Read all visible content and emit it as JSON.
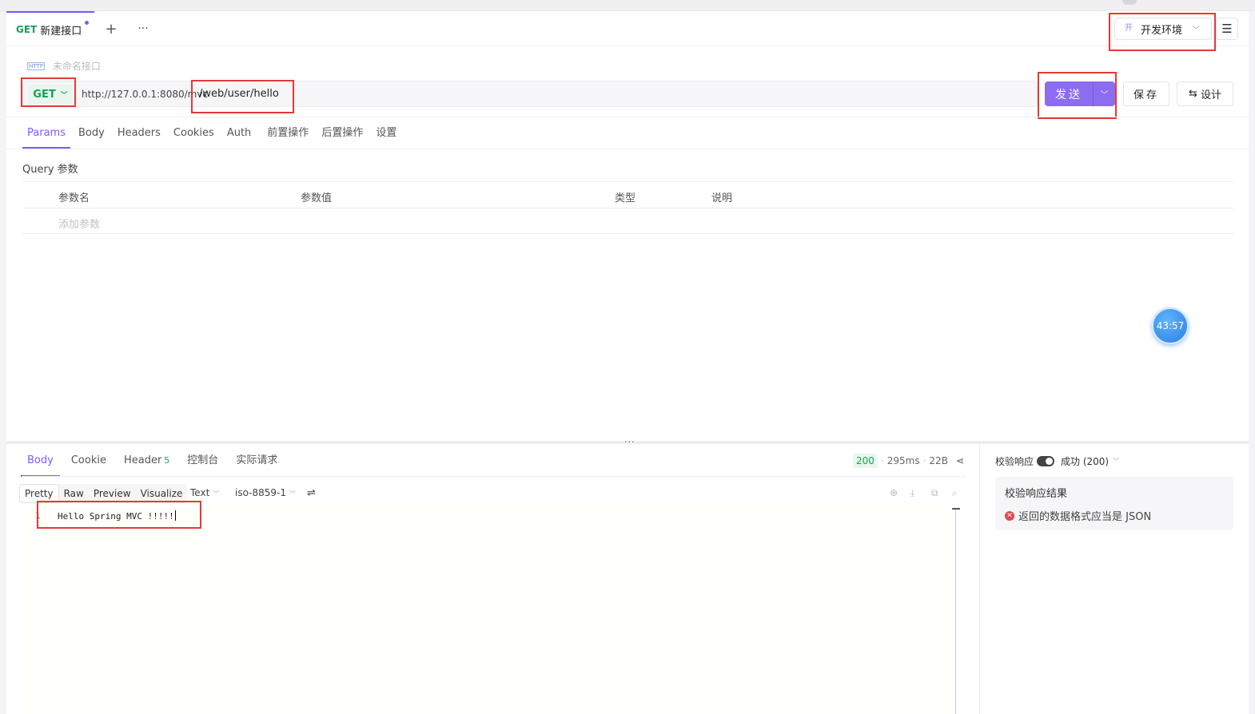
{
  "tab": {
    "method": "GET",
    "title": "新建接口"
  },
  "env": {
    "icon_text": "开",
    "name": "开发环境"
  },
  "api_name": "未命名接口",
  "http_icon": "HTTP",
  "request": {
    "method": "GET",
    "base_url": "http://127.0.0.1:8080/mvc",
    "path": "/web/user/hello",
    "send_label": "发送",
    "save_label": "保存",
    "design_label": "设计"
  },
  "req_tabs": [
    "Params",
    "Body",
    "Headers",
    "Cookies",
    "Auth",
    "前置操作",
    "后置操作",
    "设置"
  ],
  "query": {
    "label": "Query 参数",
    "headers": [
      "参数名",
      "参数值",
      "类型",
      "说明"
    ],
    "add_placeholder": "添加参数"
  },
  "timer": "43:57",
  "response": {
    "tabs": [
      {
        "label": "Body",
        "count": ""
      },
      {
        "label": "Cookie",
        "count": ""
      },
      {
        "label": "Header",
        "count": "5"
      },
      {
        "label": "控制台",
        "count": ""
      },
      {
        "label": "实际请求",
        "count": ""
      }
    ],
    "status": "200",
    "time": "295ms",
    "size": "22B",
    "views": [
      "Pretty",
      "Raw",
      "Preview",
      "Visualize"
    ],
    "format": "Text",
    "encoding": "iso-8859-1",
    "line_no": "1",
    "body": "Hello Spring MVC !!!!!"
  },
  "validation": {
    "label": "校验响应",
    "option": "成功 (200)",
    "result_title": "校验响应结果",
    "error": "返回的数据格式应当是 JSON"
  },
  "colors": {
    "accent": "#7c5cff",
    "get": "#18a058",
    "send": "#8c6cf0",
    "error": "#e5484d",
    "highlight": "#e53935"
  }
}
